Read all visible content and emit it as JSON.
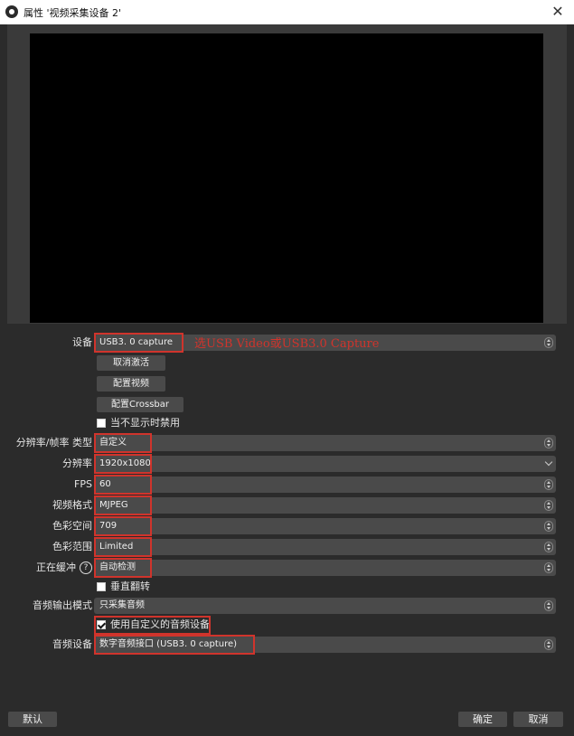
{
  "window": {
    "title": "属性 '视频采集设备 2'",
    "close_icon": "close-icon"
  },
  "device": {
    "label": "设备",
    "value": "USB3. 0 capture",
    "note": "选USB Video或USB3.0 Capture",
    "deactivate_button": "取消激活",
    "configure_video_button": "配置视频",
    "configure_crossbar_button": "配置Crossbar",
    "deactivate_when_hidden_label": "当不显示时禁用",
    "deactivate_when_hidden_checked": false
  },
  "settings": [
    {
      "label": "分辨率/帧率 类型",
      "value": "自定义"
    },
    {
      "label": "分辨率",
      "value": "1920x1080"
    },
    {
      "label": "FPS",
      "value": "60"
    },
    {
      "label": "视频格式",
      "value": "MJPEG"
    },
    {
      "label": "色彩空间",
      "value": "709"
    },
    {
      "label": "色彩范围",
      "value": "Limited"
    },
    {
      "label": "正在缓冲",
      "value": "自动检测"
    }
  ],
  "flip": {
    "label": "垂直翻转",
    "checked": false
  },
  "audio_output_mode": {
    "label": "音频输出模式",
    "value": "只采集音频"
  },
  "custom_audio": {
    "label": "使用自定义的音频设备",
    "checked": true
  },
  "audio_device": {
    "label": "音频设备",
    "value": "数字音频接口 (USB3. 0 capture)"
  },
  "footer": {
    "defaults_button": "默认",
    "ok_button": "确定",
    "cancel_button": "取消"
  },
  "colors": {
    "highlight": "#d0342c",
    "background": "#2b2b2b",
    "control": "#4a4a4a"
  }
}
